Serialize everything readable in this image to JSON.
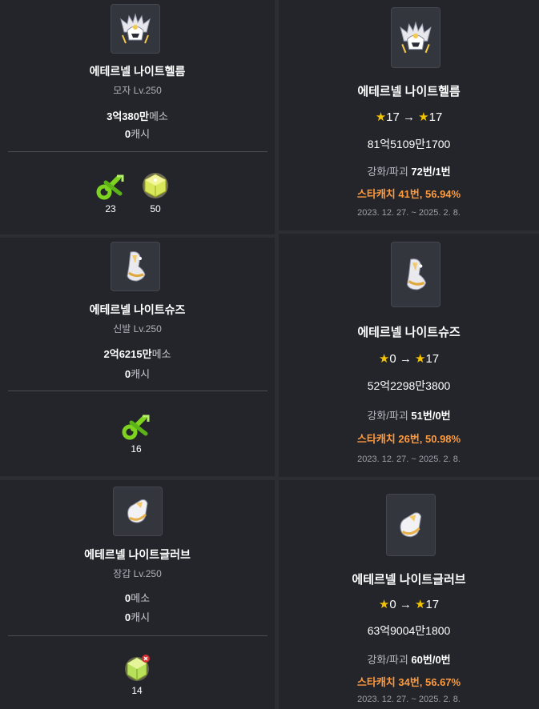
{
  "items": [
    {
      "left": {
        "icon": "helmet-icon",
        "name": "에테르넬 나이트헬름",
        "type": "모자 Lv.250",
        "meso_num": "3억380만",
        "meso_unit": "메소",
        "cash_num": "0",
        "cash_unit": "캐시",
        "badges": [
          {
            "icon": "scissors-of-karma-icon",
            "count": "23"
          },
          {
            "icon": "golden-cube-icon",
            "count": "50"
          }
        ]
      },
      "right": {
        "name": "에테르넬 나이트헬름",
        "star_from": "17",
        "arrow": "→",
        "star_to": "17",
        "meso_total": "81억5109만1700",
        "tries_label": "강화/파괴",
        "tries_value": "72번/1번",
        "catch": "스타캐치 41번, 56.94%",
        "period": "2023. 12. 27. ~ 2025. 2. 8."
      }
    },
    {
      "left": {
        "icon": "shoes-icon",
        "name": "에테르넬 나이트슈즈",
        "type": "신발 Lv.250",
        "meso_num": "2억6215만",
        "meso_unit": "메소",
        "cash_num": "0",
        "cash_unit": "캐시",
        "badges": [
          {
            "icon": "scissors-of-karma-icon",
            "count": "16"
          }
        ]
      },
      "right": {
        "name": "에테르넬 나이트슈즈",
        "star_from": "0",
        "arrow": "→",
        "star_to": "17",
        "meso_total": "52억2298만3800",
        "tries_label": "강화/파괴",
        "tries_value": "51번/0번",
        "catch": "스타캐치 26번, 50.98%",
        "period": "2023. 12. 27. ~ 2025. 2. 8."
      }
    },
    {
      "left": {
        "icon": "gloves-icon",
        "name": "에테르넬 나이트글러브",
        "type": "장갑 Lv.250",
        "meso_num": "0",
        "meso_unit": "메소",
        "cash_num": "0",
        "cash_unit": "캐시",
        "badges": [
          {
            "icon": "red-cube-icon",
            "count": "14"
          }
        ]
      },
      "right": {
        "name": "에테르넬 나이트글러브",
        "star_from": "0",
        "arrow": "→",
        "star_to": "17",
        "meso_total": "63억9004만1800",
        "tries_label": "강화/파괴",
        "tries_value": "60번/0번",
        "catch": "스타캐치 34번, 56.67%",
        "period": "2023. 12. 27. ~ 2025. 2. 8."
      }
    }
  ],
  "colors": {
    "panel": "#23252b",
    "gap": "#2c2e34",
    "star": "#f4c400",
    "starcatch": "#ff9a3c"
  }
}
